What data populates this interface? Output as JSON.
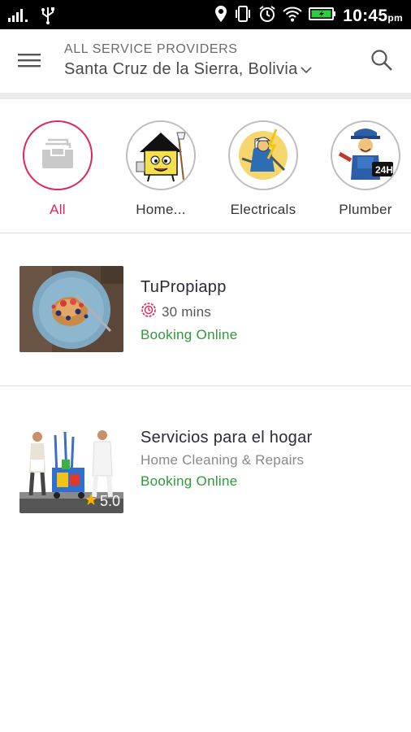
{
  "status_bar": {
    "time": "10:45",
    "ampm": "pm",
    "icons": [
      "signal-icon",
      "usb-icon",
      "location-icon",
      "vibrate-icon",
      "alarm-icon",
      "wifi-icon",
      "battery-icon"
    ]
  },
  "header": {
    "subtitle": "ALL SERVICE PROVIDERS",
    "location": "Santa Cruz de la Sierra, Bolivia",
    "icons": [
      "menu-icon",
      "chevron-down-icon",
      "search-icon"
    ]
  },
  "categories": [
    {
      "label": "All",
      "active": true,
      "icon": "inbox-icon"
    },
    {
      "label": "Home...",
      "active": false,
      "icon": "house-mascot-icon"
    },
    {
      "label": "Electricals",
      "active": false,
      "icon": "electrician-icon"
    },
    {
      "label": "Plumber",
      "active": false,
      "icon": "plumber-icon"
    }
  ],
  "providers": [
    {
      "name": "TuPropiapp",
      "detail": "30 mins",
      "detail_icon": "timer-icon",
      "status": "Booking Online",
      "image": "food-plate-image"
    },
    {
      "name": "Servicios para el hogar",
      "detail": "Home Cleaning & Repairs",
      "status": "Booking Online",
      "rating": "5.0",
      "image": "cleaning-staff-image"
    }
  ],
  "colors": {
    "accent": "#e0245e",
    "booking_green": "#2e9a3a",
    "status_bar": "#000000"
  }
}
